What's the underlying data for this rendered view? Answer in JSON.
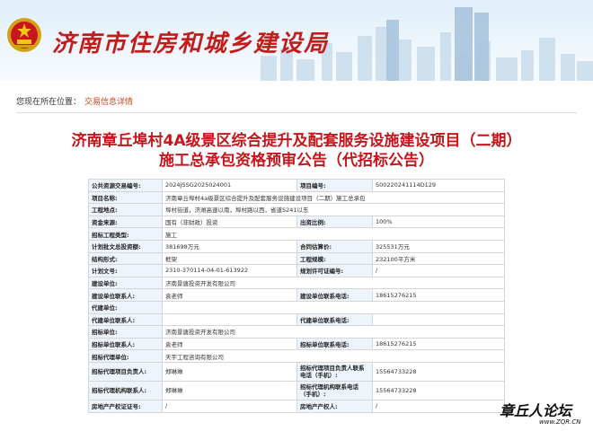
{
  "header": {
    "site_title": "济南市住房和城乡建设局",
    "emblem_icon": "national-emblem-icon",
    "skyline_image": "city-skyline"
  },
  "breadcrumb": {
    "label": "您现在所在位置：",
    "link": "交易信息详情"
  },
  "notice": {
    "title_line1": "济南章丘埠村4A级景区综合提升及配套服务设施建设项目（二期）",
    "title_line2": "施工总承包资格预审公告（代招标公告）"
  },
  "table": {
    "rows": [
      {
        "type": "pair",
        "l1": "公共资源交易编号:",
        "v1": "2024JSSG2025024001",
        "l2": "项目编号:",
        "v2": "S00220241114D129"
      },
      {
        "type": "full",
        "l1": "项目名称:",
        "v1": "济南章丘埠村4a级景区综合提升及配套服务设施建设项目（二期）施工总承包"
      },
      {
        "type": "full",
        "l1": "工程地点:",
        "v1": "埠村街道，济潍高速以南，埠村路以西，省道S241以东"
      },
      {
        "type": "pair",
        "l1": "资金来源:",
        "v1": "国有（非财政）投资",
        "l2": "出资比例:",
        "v2": "100%"
      },
      {
        "type": "full",
        "l1": "招标工程类型:",
        "v1": "施工"
      },
      {
        "type": "pair",
        "l1": "计划批文总投资额:",
        "v1": "381698万元",
        "l2": "合同估算价:",
        "v2": "325531万元"
      },
      {
        "type": "pair",
        "l1": "结构形式:",
        "v1": "框架",
        "l2": "工程规模:",
        "v2": "232100平方米"
      },
      {
        "type": "pair",
        "l1": "计划文号:",
        "v1": "2310-370114-04-01-613922",
        "l2": "规划许可证编号:",
        "v2": "/"
      },
      {
        "type": "full",
        "l1": "建设单位:",
        "v1": "济南景唐投资开发有限公司"
      },
      {
        "type": "pair",
        "l1": "建设单位联系人:",
        "v1": "袁老师",
        "l2": "建设单位联系电话:",
        "v2": "18615276215"
      },
      {
        "type": "full",
        "l1": "代建单位:",
        "v1": ""
      },
      {
        "type": "pair",
        "l1": "代建单位联系人:",
        "v1": "",
        "l2": "代建单位联系电话:",
        "v2": ""
      },
      {
        "type": "full",
        "l1": "招标单位:",
        "v1": "济南景唐投资开发有限公司"
      },
      {
        "type": "pair",
        "l1": "招标单位联系人:",
        "v1": "袁老师",
        "l2": "招标单位联系电话:",
        "v2": "18615276215"
      },
      {
        "type": "full",
        "l1": "招标代理单位:",
        "v1": "天宇工程咨询有限公司"
      },
      {
        "type": "tall",
        "l1": "招标代理项目负责人:",
        "v1": "郑琳琳",
        "l2": "招标代理项目负责人联系电话（手机）:",
        "v2": "15564733228"
      },
      {
        "type": "tall",
        "l1": "招标代理机构联系人:",
        "v1": "郑琳琳",
        "l2": "招标代理机构联系电话（手机）:",
        "v2": "15564733228"
      },
      {
        "type": "pair",
        "l1": "房地产产权证证号:",
        "v1": "/",
        "l2": "房地产产权人:",
        "v2": "/"
      }
    ]
  },
  "watermark": {
    "text": "章丘人论坛",
    "url": "www.ZQR.CN"
  }
}
